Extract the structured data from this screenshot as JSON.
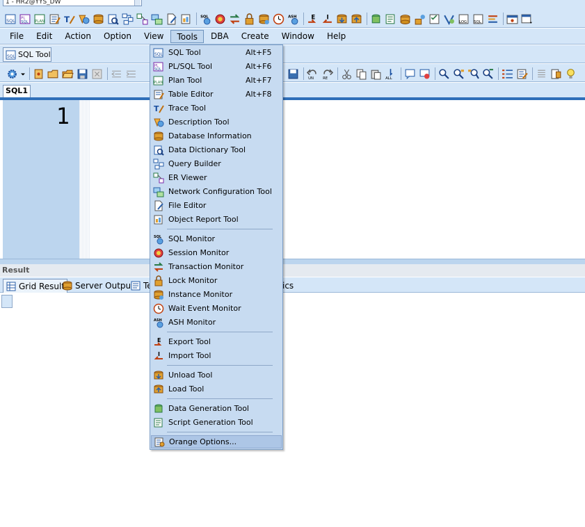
{
  "connection": {
    "label": "1 - HR2@YYS_DW"
  },
  "menubar": {
    "items": [
      {
        "key": "file",
        "label": "File"
      },
      {
        "key": "edit",
        "label": "Edit"
      },
      {
        "key": "action",
        "label": "Action"
      },
      {
        "key": "option",
        "label": "Option"
      },
      {
        "key": "view",
        "label": "View"
      },
      {
        "key": "tools",
        "label": "Tools",
        "active": true
      },
      {
        "key": "dba",
        "label": "DBA"
      },
      {
        "key": "create",
        "label": "Create"
      },
      {
        "key": "window",
        "label": "Window"
      },
      {
        "key": "help",
        "label": "Help"
      }
    ]
  },
  "doc_tab": {
    "label": "SQL Tool"
  },
  "editor": {
    "tab_label": "SQL1",
    "line_number": "1"
  },
  "result": {
    "title": "Result",
    "tabs": [
      {
        "key": "grid-result",
        "label": "Grid Result",
        "active": true
      },
      {
        "key": "server-output",
        "label": "Server Output"
      },
      {
        "key": "te",
        "label": "Te"
      },
      {
        "key": "ics",
        "label": "ics"
      }
    ]
  },
  "tools_menu": {
    "items": [
      {
        "key": "sql-tool",
        "label": "SQL Tool",
        "shortcut": "Alt+F5",
        "icon": "sql-icon"
      },
      {
        "key": "plsql-tool",
        "label": "PL/SQL Tool",
        "shortcut": "Alt+F6",
        "icon": "plsql-icon"
      },
      {
        "key": "plan-tool",
        "label": "Plan Tool",
        "shortcut": "Alt+F7",
        "icon": "plan-icon"
      },
      {
        "key": "table-editor",
        "label": "Table Editor",
        "shortcut": "Alt+F8",
        "icon": "table-edit-icon"
      },
      {
        "key": "trace-tool",
        "label": "Trace Tool",
        "shortcut": "",
        "icon": "trace-icon"
      },
      {
        "key": "description-tool",
        "label": "Description Tool",
        "shortcut": "",
        "icon": "description-icon"
      },
      {
        "key": "database-information",
        "label": "Database Information",
        "shortcut": "",
        "icon": "database-icon"
      },
      {
        "key": "data-dictionary-tool",
        "label": "Data Dictionary Tool",
        "shortcut": "",
        "icon": "dictionary-icon"
      },
      {
        "key": "query-builder",
        "label": "Query Builder",
        "shortcut": "",
        "icon": "query-builder-icon"
      },
      {
        "key": "er-viewer",
        "label": "ER Viewer",
        "shortcut": "",
        "icon": "er-viewer-icon"
      },
      {
        "key": "network-configuration-tool",
        "label": "Network Configuration Tool",
        "shortcut": "",
        "icon": "network-icon"
      },
      {
        "key": "file-editor",
        "label": "File Editor",
        "shortcut": "",
        "icon": "file-edit-icon"
      },
      {
        "key": "object-report-tool",
        "label": "Object Report Tool",
        "shortcut": "",
        "icon": "report-icon"
      },
      {
        "key": "sql-monitor",
        "label": "SQL Monitor",
        "shortcut": "",
        "icon": "sql-monitor-icon"
      },
      {
        "key": "session-monitor",
        "label": "Session Monitor",
        "shortcut": "",
        "icon": "session-monitor-icon"
      },
      {
        "key": "transaction-monitor",
        "label": "Transaction Monitor",
        "shortcut": "",
        "icon": "transaction-icon"
      },
      {
        "key": "lock-monitor",
        "label": "Lock Monitor",
        "shortcut": "",
        "icon": "lock-icon"
      },
      {
        "key": "instance-monitor",
        "label": "Instance Monitor",
        "shortcut": "",
        "icon": "instance-icon"
      },
      {
        "key": "wait-event-monitor",
        "label": "Wait Event Monitor",
        "shortcut": "",
        "icon": "clock-icon"
      },
      {
        "key": "ash-monitor",
        "label": "ASH Monitor",
        "shortcut": "",
        "icon": "ash-icon"
      },
      {
        "key": "export-tool",
        "label": "Export Tool",
        "shortcut": "",
        "icon": "export-icon"
      },
      {
        "key": "import-tool",
        "label": "Import Tool",
        "shortcut": "",
        "icon": "import-icon"
      },
      {
        "key": "unload-tool",
        "label": "Unload Tool",
        "shortcut": "",
        "icon": "unload-icon"
      },
      {
        "key": "load-tool",
        "label": "Load Tool",
        "shortcut": "",
        "icon": "load-icon"
      },
      {
        "key": "data-generation-tool",
        "label": "Data Generation Tool",
        "shortcut": "",
        "icon": "data-generation-icon"
      },
      {
        "key": "script-generation-tool",
        "label": "Script Generation Tool",
        "shortcut": "",
        "icon": "script-generation-icon"
      },
      {
        "key": "orange-options",
        "label": "Orange Options...",
        "shortcut": "",
        "icon": "options-icon",
        "highlighted": true
      }
    ]
  },
  "colors": {
    "toolbar_bg": "#d4e6f8",
    "menu_bg": "#c7dbf1",
    "menu_highlight": "#adc6e6",
    "editor_underline": "#2f6fb9"
  }
}
